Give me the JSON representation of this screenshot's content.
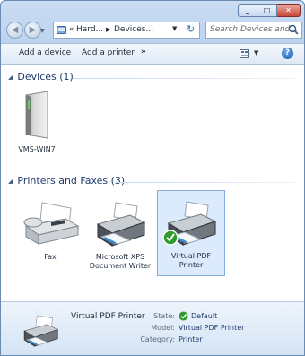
{
  "navbar": {
    "breadcrumb_1": "Hard...",
    "breadcrumb_2": "Devices...",
    "search_placeholder": "Search Devices and..."
  },
  "toolbar": {
    "add_device": "Add a device",
    "add_printer": "Add a printer",
    "more": "»"
  },
  "groups": {
    "devices": {
      "header": "Devices (1)",
      "items": [
        {
          "label": "VMS-WIN7"
        }
      ]
    },
    "printers": {
      "header": "Printers and Faxes (3)",
      "items": [
        {
          "label": "Fax"
        },
        {
          "label_line1": "Microsoft XPS",
          "label_line2": "Document Writer"
        },
        {
          "label_line1": "Virtual PDF",
          "label_line2": "Printer",
          "selected": true,
          "default": true
        }
      ]
    }
  },
  "details": {
    "name": "Virtual PDF Printer",
    "state_label": "State:",
    "state_value": "Default",
    "model_label": "Model:",
    "model_value": "Virtual PDF Printer",
    "category_label": "Category:",
    "category_value": "Printer"
  },
  "colors": {
    "accent": "#1e3a6e",
    "selection": "#dbeafc",
    "default_check": "#2e9a2e"
  }
}
